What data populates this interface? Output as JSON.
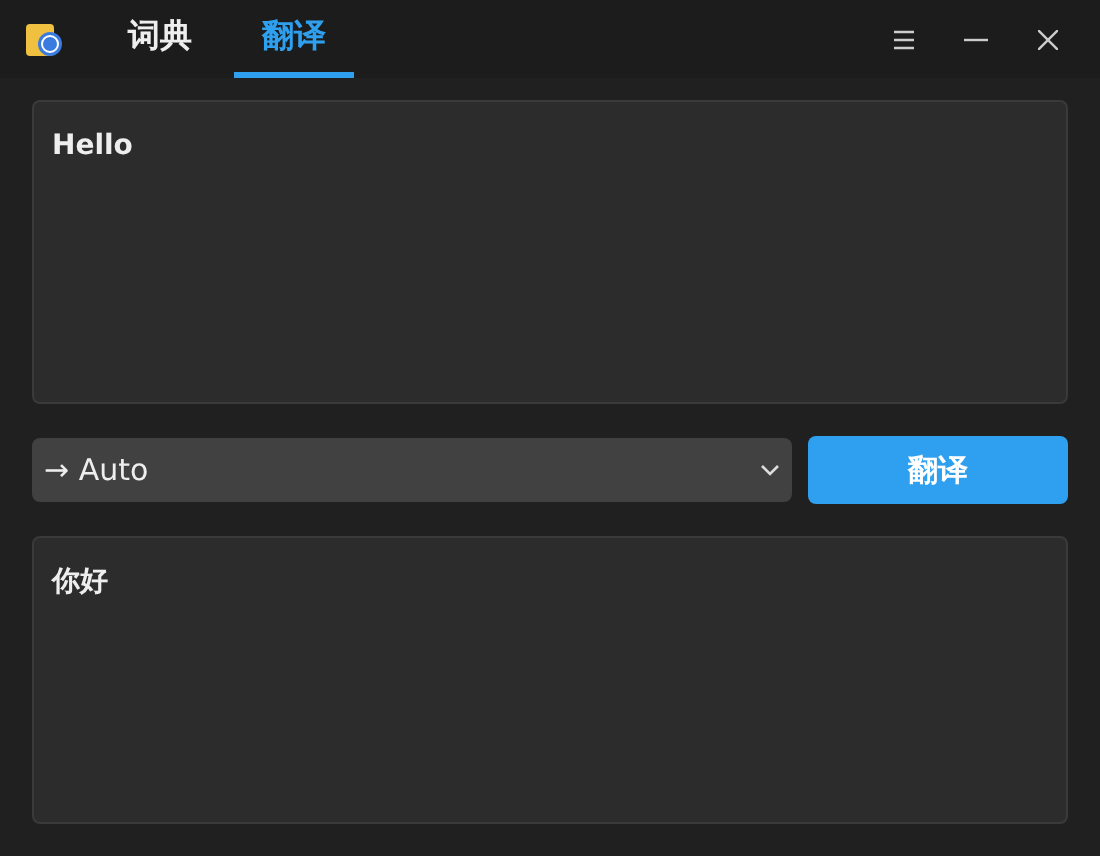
{
  "tabs": [
    {
      "label": "词典",
      "selected": false
    },
    {
      "label": "翻译",
      "selected": true
    }
  ],
  "source_text": "Hello",
  "language_select": {
    "value": "→ Auto"
  },
  "translate_button": "翻译",
  "result_text": "你好"
}
